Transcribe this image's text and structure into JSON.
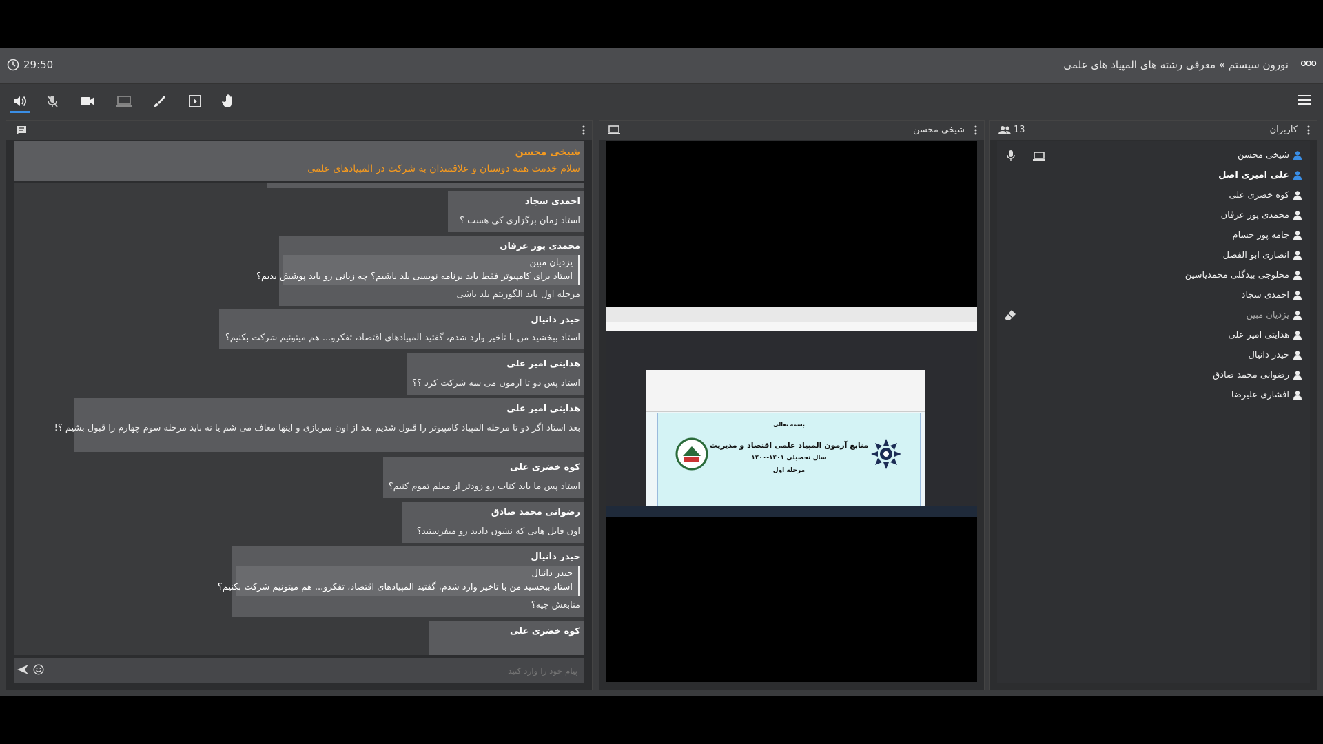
{
  "timer": "29:50",
  "title": "نورون سیستم » معرفی رشته های المپیاد های علمی",
  "logo": "ooo",
  "chat": {
    "pinned": {
      "name": "شیخی محسن",
      "text": "سلام خدمت همه دوستان و علاقمندان به شرکت در المپیادهای علمی"
    },
    "placeholder": "پیام خود را وارد کنید",
    "messages": [
      {
        "name": "احمدی سجاد",
        "lines": [
          "استاد زمان برگزاری کی هست ؟"
        ]
      },
      {
        "name": "محمدی پور عرفان",
        "quote": [
          "یزدیان مبین",
          "استاد برای کامپیوتر فقط باید برنامه نویسی بلد باشیم؟ چه زبانی رو باید پوشش بدیم؟"
        ],
        "lines": [
          "مرحله اول باید الگوریتم بلد باشی"
        ]
      },
      {
        "name": "حیدر دانیال",
        "lines": [
          "استاد ببخشید من با تاخیر وارد شدم، گفتید المپیادهای اقتصاد، تفکرو... هم میتونیم شرکت بکنیم؟"
        ]
      },
      {
        "name": "هدایتی امیر علی",
        "lines": [
          "استاد پس دو تا آزمون می سه شرکت کرد ؟؟"
        ]
      },
      {
        "name": "هدایتی امیر علی",
        "lines": [
          "بعد استاد اگر دو تا مرحله المپیاد   کامپیوتر را قبول شدیم بعد از اون    سربازی و اینها معاف می شم یا نه باید مرحله سوم چهارم را قبول بشیم ؟!"
        ]
      },
      {
        "name": "کوه خضری علی",
        "lines": [
          "استاد پس ما باید کتاب رو زودتر از معلم تموم کنیم؟"
        ]
      },
      {
        "name": "رضوانی محمد صادق",
        "lines": [
          "اون فایل هایی که نشون دادید رو میفرستید؟"
        ]
      },
      {
        "name": "حیدر دانیال",
        "quote": [
          "حیدر دانیال",
          "استاد ببخشید من با تاخیر وارد شدم، گفتید المپیادهای اقتصاد، تفکرو... هم میتونیم شرکت بکنیم؟"
        ],
        "lines": [
          "منابعش چیه؟"
        ]
      },
      {
        "name": "کوه خضری علی",
        "lines": [
          ""
        ]
      }
    ]
  },
  "presenter": {
    "name": "شیخی محسن",
    "slide_title_1": "منابع آزمون المپیاد علمی اقتصاد و مدیریت",
    "slide_title_2": "سال تحصیلی ۱۴۰۱-۱۴۰۰",
    "slide_title_3": "مرحله اول",
    "slide_top": "بسمه تعالی"
  },
  "users": {
    "header": "کاربران",
    "count": "13",
    "list": [
      {
        "name": "شیخی محسن",
        "style": "normal",
        "icon_color": "#3a8ee6"
      },
      {
        "name": "علی امیری اصل",
        "style": "bold",
        "icon_color": "#3a8ee6"
      },
      {
        "name": "کوه خضری علی",
        "style": "normal",
        "icon_color": "#eee"
      },
      {
        "name": "محمدی پور عرفان",
        "style": "normal",
        "icon_color": "#eee"
      },
      {
        "name": "جامه پور حسام",
        "style": "normal",
        "icon_color": "#eee"
      },
      {
        "name": "انصاری ابو الفضل",
        "style": "normal",
        "icon_color": "#eee"
      },
      {
        "name": "محلوجی بیدگلی محمدیاسین",
        "style": "normal",
        "icon_color": "#eee"
      },
      {
        "name": "احمدی سجاد",
        "style": "normal",
        "icon_color": "#eee"
      },
      {
        "name": "یزدیان مبین",
        "style": "dim",
        "icon_color": "#eee"
      },
      {
        "name": "هدایتی امیر علی",
        "style": "normal",
        "icon_color": "#eee"
      },
      {
        "name": "حیدر دانیال",
        "style": "normal",
        "icon_color": "#eee"
      },
      {
        "name": "رضوانی محمد صادق",
        "style": "normal",
        "icon_color": "#eee"
      },
      {
        "name": "افشاری علیرضا",
        "style": "normal",
        "icon_color": "#eee"
      }
    ]
  }
}
